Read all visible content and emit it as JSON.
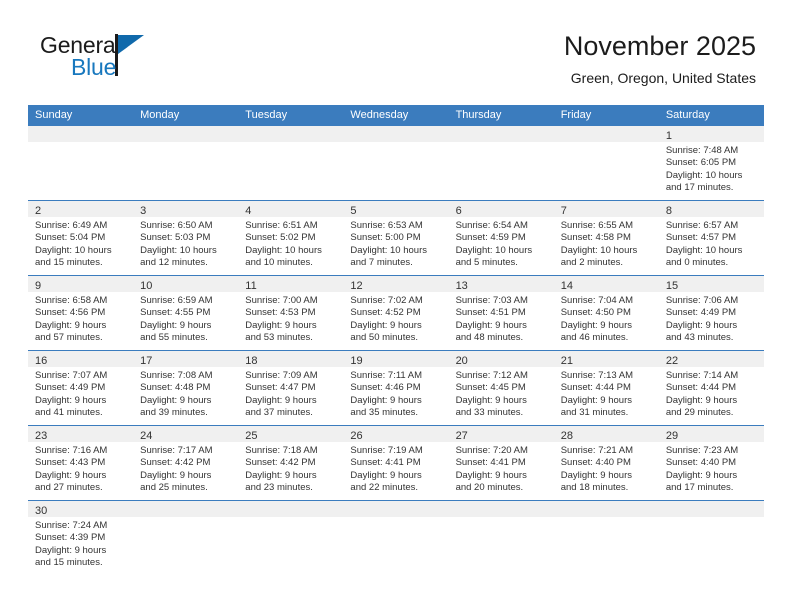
{
  "brand": {
    "name_top": "General",
    "name_bottom": "Blue",
    "accent_color": "#1069ab",
    "text_color": "#1b1b1b"
  },
  "header": {
    "month_title": "November 2025",
    "location": "Green, Oregon, United States"
  },
  "theme": {
    "header_blue": "#3b7cbe",
    "day_band_gray": "#f0f0f0",
    "text": "#333333",
    "page_background": "#ffffff"
  },
  "weekdays": [
    "Sunday",
    "Monday",
    "Tuesday",
    "Wednesday",
    "Thursday",
    "Friday",
    "Saturday"
  ],
  "labels": {
    "sunrise_prefix": "Sunrise:",
    "sunset_prefix": "Sunset:",
    "daylight_prefix": "Daylight:"
  },
  "weeks": [
    [
      {
        "empty": true
      },
      {
        "empty": true
      },
      {
        "empty": true
      },
      {
        "empty": true
      },
      {
        "empty": true
      },
      {
        "empty": true
      },
      {
        "day": "1",
        "sunrise": "Sunrise: 7:48 AM",
        "sunset": "Sunset: 6:05 PM",
        "daylight_1": "Daylight: 10 hours",
        "daylight_2": "and 17 minutes."
      }
    ],
    [
      {
        "day": "2",
        "sunrise": "Sunrise: 6:49 AM",
        "sunset": "Sunset: 5:04 PM",
        "daylight_1": "Daylight: 10 hours",
        "daylight_2": "and 15 minutes."
      },
      {
        "day": "3",
        "sunrise": "Sunrise: 6:50 AM",
        "sunset": "Sunset: 5:03 PM",
        "daylight_1": "Daylight: 10 hours",
        "daylight_2": "and 12 minutes."
      },
      {
        "day": "4",
        "sunrise": "Sunrise: 6:51 AM",
        "sunset": "Sunset: 5:02 PM",
        "daylight_1": "Daylight: 10 hours",
        "daylight_2": "and 10 minutes."
      },
      {
        "day": "5",
        "sunrise": "Sunrise: 6:53 AM",
        "sunset": "Sunset: 5:00 PM",
        "daylight_1": "Daylight: 10 hours",
        "daylight_2": "and 7 minutes."
      },
      {
        "day": "6",
        "sunrise": "Sunrise: 6:54 AM",
        "sunset": "Sunset: 4:59 PM",
        "daylight_1": "Daylight: 10 hours",
        "daylight_2": "and 5 minutes."
      },
      {
        "day": "7",
        "sunrise": "Sunrise: 6:55 AM",
        "sunset": "Sunset: 4:58 PM",
        "daylight_1": "Daylight: 10 hours",
        "daylight_2": "and 2 minutes."
      },
      {
        "day": "8",
        "sunrise": "Sunrise: 6:57 AM",
        "sunset": "Sunset: 4:57 PM",
        "daylight_1": "Daylight: 10 hours",
        "daylight_2": "and 0 minutes."
      }
    ],
    [
      {
        "day": "9",
        "sunrise": "Sunrise: 6:58 AM",
        "sunset": "Sunset: 4:56 PM",
        "daylight_1": "Daylight: 9 hours",
        "daylight_2": "and 57 minutes."
      },
      {
        "day": "10",
        "sunrise": "Sunrise: 6:59 AM",
        "sunset": "Sunset: 4:55 PM",
        "daylight_1": "Daylight: 9 hours",
        "daylight_2": "and 55 minutes."
      },
      {
        "day": "11",
        "sunrise": "Sunrise: 7:00 AM",
        "sunset": "Sunset: 4:53 PM",
        "daylight_1": "Daylight: 9 hours",
        "daylight_2": "and 53 minutes."
      },
      {
        "day": "12",
        "sunrise": "Sunrise: 7:02 AM",
        "sunset": "Sunset: 4:52 PM",
        "daylight_1": "Daylight: 9 hours",
        "daylight_2": "and 50 minutes."
      },
      {
        "day": "13",
        "sunrise": "Sunrise: 7:03 AM",
        "sunset": "Sunset: 4:51 PM",
        "daylight_1": "Daylight: 9 hours",
        "daylight_2": "and 48 minutes."
      },
      {
        "day": "14",
        "sunrise": "Sunrise: 7:04 AM",
        "sunset": "Sunset: 4:50 PM",
        "daylight_1": "Daylight: 9 hours",
        "daylight_2": "and 46 minutes."
      },
      {
        "day": "15",
        "sunrise": "Sunrise: 7:06 AM",
        "sunset": "Sunset: 4:49 PM",
        "daylight_1": "Daylight: 9 hours",
        "daylight_2": "and 43 minutes."
      }
    ],
    [
      {
        "day": "16",
        "sunrise": "Sunrise: 7:07 AM",
        "sunset": "Sunset: 4:49 PM",
        "daylight_1": "Daylight: 9 hours",
        "daylight_2": "and 41 minutes."
      },
      {
        "day": "17",
        "sunrise": "Sunrise: 7:08 AM",
        "sunset": "Sunset: 4:48 PM",
        "daylight_1": "Daylight: 9 hours",
        "daylight_2": "and 39 minutes."
      },
      {
        "day": "18",
        "sunrise": "Sunrise: 7:09 AM",
        "sunset": "Sunset: 4:47 PM",
        "daylight_1": "Daylight: 9 hours",
        "daylight_2": "and 37 minutes."
      },
      {
        "day": "19",
        "sunrise": "Sunrise: 7:11 AM",
        "sunset": "Sunset: 4:46 PM",
        "daylight_1": "Daylight: 9 hours",
        "daylight_2": "and 35 minutes."
      },
      {
        "day": "20",
        "sunrise": "Sunrise: 7:12 AM",
        "sunset": "Sunset: 4:45 PM",
        "daylight_1": "Daylight: 9 hours",
        "daylight_2": "and 33 minutes."
      },
      {
        "day": "21",
        "sunrise": "Sunrise: 7:13 AM",
        "sunset": "Sunset: 4:44 PM",
        "daylight_1": "Daylight: 9 hours",
        "daylight_2": "and 31 minutes."
      },
      {
        "day": "22",
        "sunrise": "Sunrise: 7:14 AM",
        "sunset": "Sunset: 4:44 PM",
        "daylight_1": "Daylight: 9 hours",
        "daylight_2": "and 29 minutes."
      }
    ],
    [
      {
        "day": "23",
        "sunrise": "Sunrise: 7:16 AM",
        "sunset": "Sunset: 4:43 PM",
        "daylight_1": "Daylight: 9 hours",
        "daylight_2": "and 27 minutes."
      },
      {
        "day": "24",
        "sunrise": "Sunrise: 7:17 AM",
        "sunset": "Sunset: 4:42 PM",
        "daylight_1": "Daylight: 9 hours",
        "daylight_2": "and 25 minutes."
      },
      {
        "day": "25",
        "sunrise": "Sunrise: 7:18 AM",
        "sunset": "Sunset: 4:42 PM",
        "daylight_1": "Daylight: 9 hours",
        "daylight_2": "and 23 minutes."
      },
      {
        "day": "26",
        "sunrise": "Sunrise: 7:19 AM",
        "sunset": "Sunset: 4:41 PM",
        "daylight_1": "Daylight: 9 hours",
        "daylight_2": "and 22 minutes."
      },
      {
        "day": "27",
        "sunrise": "Sunrise: 7:20 AM",
        "sunset": "Sunset: 4:41 PM",
        "daylight_1": "Daylight: 9 hours",
        "daylight_2": "and 20 minutes."
      },
      {
        "day": "28",
        "sunrise": "Sunrise: 7:21 AM",
        "sunset": "Sunset: 4:40 PM",
        "daylight_1": "Daylight: 9 hours",
        "daylight_2": "and 18 minutes."
      },
      {
        "day": "29",
        "sunrise": "Sunrise: 7:23 AM",
        "sunset": "Sunset: 4:40 PM",
        "daylight_1": "Daylight: 9 hours",
        "daylight_2": "and 17 minutes."
      }
    ],
    [
      {
        "day": "30",
        "sunrise": "Sunrise: 7:24 AM",
        "sunset": "Sunset: 4:39 PM",
        "daylight_1": "Daylight: 9 hours",
        "daylight_2": "and 15 minutes."
      },
      {
        "empty": true
      },
      {
        "empty": true
      },
      {
        "empty": true
      },
      {
        "empty": true
      },
      {
        "empty": true
      },
      {
        "empty": true
      }
    ]
  ]
}
